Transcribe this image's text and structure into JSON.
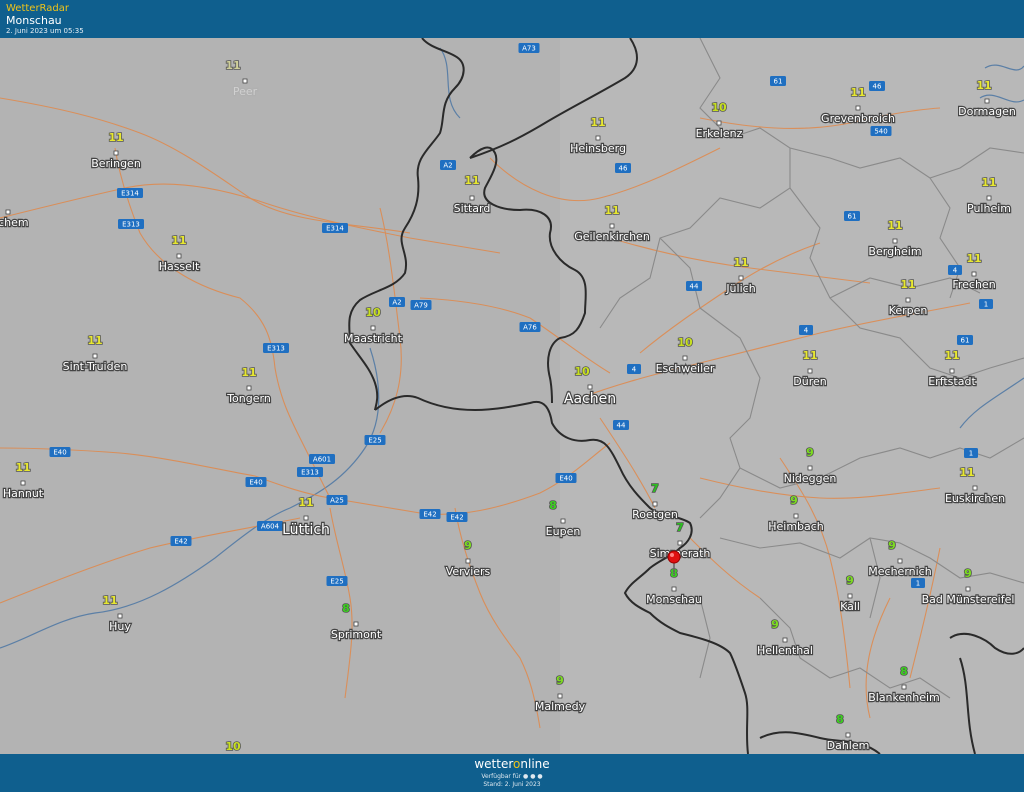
{
  "header": {
    "brand": "WetterRadar",
    "location": "Monschau",
    "date": "2. Juni 2023 um 05:35"
  },
  "footer": {
    "logo_a": "wetter",
    "logo_b": "o",
    "logo_c": "nline",
    "available": "Verfügbar für",
    "stand": "Stand: 2. Juni 2023"
  },
  "colors": {
    "temp_11": "#e8e830",
    "temp_10": "#c8e020",
    "temp_9": "#7cdc20",
    "temp_8": "#3cd020",
    "temp_7": "#2cc020",
    "marker": "#e01010"
  },
  "marker": {
    "icon": "map-pin-icon",
    "name": "Monschau"
  },
  "cities": [
    {
      "name": "Peer",
      "temp": "11",
      "faded": true
    },
    {
      "name": "Beringen",
      "temp": "11"
    },
    {
      "name": "Heinsberg",
      "temp": "11"
    },
    {
      "name": "Erkelenz",
      "temp": "10"
    },
    {
      "name": "Grevenbroich",
      "temp": "11"
    },
    {
      "name": "Dormagen",
      "temp": "11"
    },
    {
      "name": "Zichem",
      "temp": ""
    },
    {
      "name": "Sittard",
      "temp": "11"
    },
    {
      "name": "Pulheim",
      "temp": "11"
    },
    {
      "name": "Hasselt",
      "temp": "11"
    },
    {
      "name": "Geilenkirchen",
      "temp": "11"
    },
    {
      "name": "Bergheim",
      "temp": "11"
    },
    {
      "name": "Jülich",
      "temp": "11"
    },
    {
      "name": "Frechen",
      "temp": "11"
    },
    {
      "name": "Kerpen",
      "temp": "11"
    },
    {
      "name": "Maastricht",
      "temp": "10"
    },
    {
      "name": "Sint-Truiden",
      "temp": "11"
    },
    {
      "name": "Eschweiler",
      "temp": "10"
    },
    {
      "name": "Düren",
      "temp": "11"
    },
    {
      "name": "Erftstadt",
      "temp": "11"
    },
    {
      "name": "Tongern",
      "temp": "11"
    },
    {
      "name": "Aachen",
      "temp": "10",
      "big": true
    },
    {
      "name": "Hannut",
      "temp": "11"
    },
    {
      "name": "Nideggen",
      "temp": "9"
    },
    {
      "name": "Euskirchen",
      "temp": "11"
    },
    {
      "name": "Roetgen",
      "temp": "7"
    },
    {
      "name": "Lüttich",
      "temp": "11",
      "big": true
    },
    {
      "name": "Eupen",
      "temp": "8"
    },
    {
      "name": "Heimbach",
      "temp": "9"
    },
    {
      "name": "Simmerath",
      "temp": "7"
    },
    {
      "name": "Verviers",
      "temp": "9"
    },
    {
      "name": "Mechernich",
      "temp": "9"
    },
    {
      "name": "Monschau",
      "temp": "8"
    },
    {
      "name": "Kall",
      "temp": "9"
    },
    {
      "name": "Bad Münstereifel",
      "temp": "9"
    },
    {
      "name": "Huy",
      "temp": "11"
    },
    {
      "name": "Sprimont",
      "temp": "8"
    },
    {
      "name": "Hellenthal",
      "temp": "9"
    },
    {
      "name": "Blankenheim",
      "temp": "8"
    },
    {
      "name": "Malmedy",
      "temp": "9"
    },
    {
      "name": "Dahlem",
      "temp": "8"
    },
    {
      "name": "",
      "temp": "10"
    }
  ],
  "roads": [
    "A73",
    "61",
    "46",
    "540",
    "A2",
    "46",
    "E314",
    "E313",
    "E314",
    "61",
    "4",
    "A2",
    "A79",
    "A76",
    "44",
    "1",
    "4",
    "E313",
    "61",
    "4",
    "E25",
    "E40",
    "A601",
    "44",
    "E40",
    "E313",
    "A25",
    "1",
    "A604",
    "E40",
    "E42",
    "E42",
    "E25",
    "1",
    "E42"
  ]
}
